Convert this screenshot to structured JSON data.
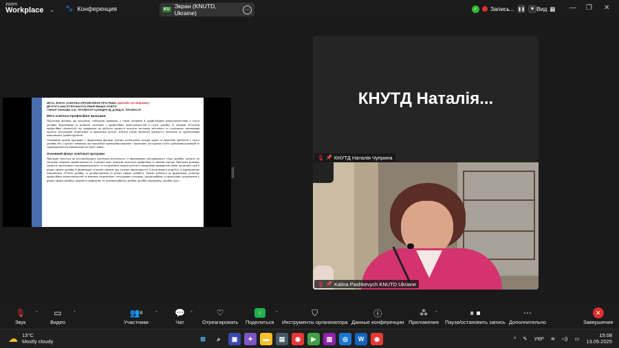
{
  "titlebar": {
    "app_line1": "zoom",
    "app_line2": "Workplace",
    "dropdown_icon": "chevron-down-icon",
    "conference_label": "Конференция",
    "share_badge": "KU",
    "share_title": "Экран (KNUTD, Ukraine)",
    "record_label": "Запись...",
    "view_label": "Вид"
  },
  "slide": {
    "heading_line1": "МЕТА, ФОКУС ОСВІТНЬО-ПРОФЕСІЙНОЇ ПРОГРАМИ",
    "heading_highlight": "«ДИЗАЙН (ЗА ВИДАМИ)»",
    "heading_line2": "ДРУГОГО (МАГІСТЕРСЬКОГО) РІВНЯ ВИЩОЇ ОСВІТИ",
    "heading_line3": "ГАРАНТ КЮЖОВА О.В., ПРОФЕСОР КАФЕДРИ ІД, Д.ПЕД.Н., ПРОФЕСОР",
    "section1_title": "Мета освітньо-професійної програми",
    "section1_text": "Підготовка фахівця, які володіють глибокими знаннями, а також базовими й професійними компетентностями в галузі дизайну, формування та розвиток загальних і професійних компетентностей в галузі дизайну (з умінням об'єктами професійної діяльності), що направлені на здобуття здатності володіти методами змістового та соціального наповнення проекту, методиками теоретичної та практичної роботи, змістом етапів проектної діяльності, вимогами до проектування комплексних дизайн-проектів.",
    "section1_text2": "Основними цілями програми є: формування фахівця, здатних розв'язувати складні задачі та практичні проблеми у галузі дизайну або у процесі навчання, що передбачає проведення наукових і проектних досліджень та/або здійснення інновацій та характеризуються невизначеністю умов і вимог.",
    "section2_title": "Основний фокус освітньої програми",
    "section2_text": "Програма базується на загальновідомих проектних результатах, із врахуванням сьогоднішнього стану дизайну, орієнтує на актуальні напрями дизайн-діяльності, в рамках яких можлива подальша професійна та наукова кар'єра. Програма розвиває здатність аналітичного експериментального та асоціативної творчої роботи в генеруванні принципово нових проектних ідей в різних сферах дизайну й формуванні сучасних уявлень про основні закономірності й досягнення в розробці та впровадженні комплексних об'єктів дизайну та дизайн-проектів (в різних сферах дизайну). Акцент робиться на формуванні, розвитку професійних компетентностей та вивченні теоретичних і методичних положень, організаційних та практичних інструментів у різних сферах дизайну, зокрема в графічному та мультимедійному дизайні, дизайні середовища, дизайні одягу."
  },
  "participants": {
    "tile1_display_name": "КНУТД  Наталія...",
    "tile1_nameplate": "КНУТД Наталія Чуприна",
    "tile2_nameplate": "Kalina Pashkevych KNUTD Ukraine"
  },
  "toolbar": {
    "mute_label": "Звук",
    "video_label": "Видео",
    "participants_label": "Участники",
    "participants_count": "8",
    "chat_label": "Чат",
    "react_label": "Отреагировать",
    "share_label": "Поделиться",
    "host_tools_label": "Инструменты организатора",
    "meeting_info_label": "Данные конференции",
    "apps_label": "Приложения",
    "pause_record_label": "Пауза/остановить запись",
    "more_label": "Дополнительно",
    "end_label": "Завершение"
  },
  "taskbar": {
    "temperature": "13°C",
    "weather_text": "Mostly cloudy",
    "language": "УКР",
    "time": "15:08",
    "date": "13.05.2025",
    "app_icons": [
      "windows-start-icon",
      "search-icon",
      "widgets-icon",
      "copilot-icon",
      "file-explorer-icon",
      "store-icon",
      "chrome-icon",
      "zoom-icon",
      "winrar-icon",
      "browser-icon",
      "word-icon",
      "chrome-profile-icon"
    ]
  },
  "colors": {
    "accent_green": "#22b14c",
    "end_red": "#e02e2e",
    "slide_band": "#4a6fb0",
    "highlight_red": "#c62828"
  }
}
